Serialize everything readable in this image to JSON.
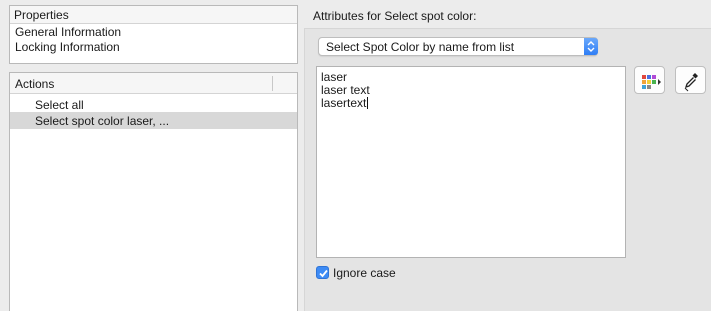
{
  "properties": {
    "header": "Properties",
    "items": [
      "General Information",
      "Locking Information"
    ]
  },
  "actions": {
    "header": "Actions",
    "items": [
      {
        "label": "Select all",
        "selected": false
      },
      {
        "label": "Select spot color laser, ...",
        "selected": true
      }
    ]
  },
  "attributes": {
    "label": "Attributes for Select spot color:",
    "mode_select": {
      "value": "Select Spot Color by name from list"
    },
    "names": [
      "laser",
      "laser text",
      "lasertext"
    ],
    "palette_button": {
      "icon": "color-palette-menu-icon"
    },
    "eyedropper_button": {
      "icon": "eyedropper-icon"
    },
    "ignore_case": {
      "label": "Ignore case",
      "checked": true
    }
  },
  "colors": {
    "accent": "#3d8bf5",
    "selection": "#d8d8d8",
    "panel": "#e4e4e4"
  }
}
